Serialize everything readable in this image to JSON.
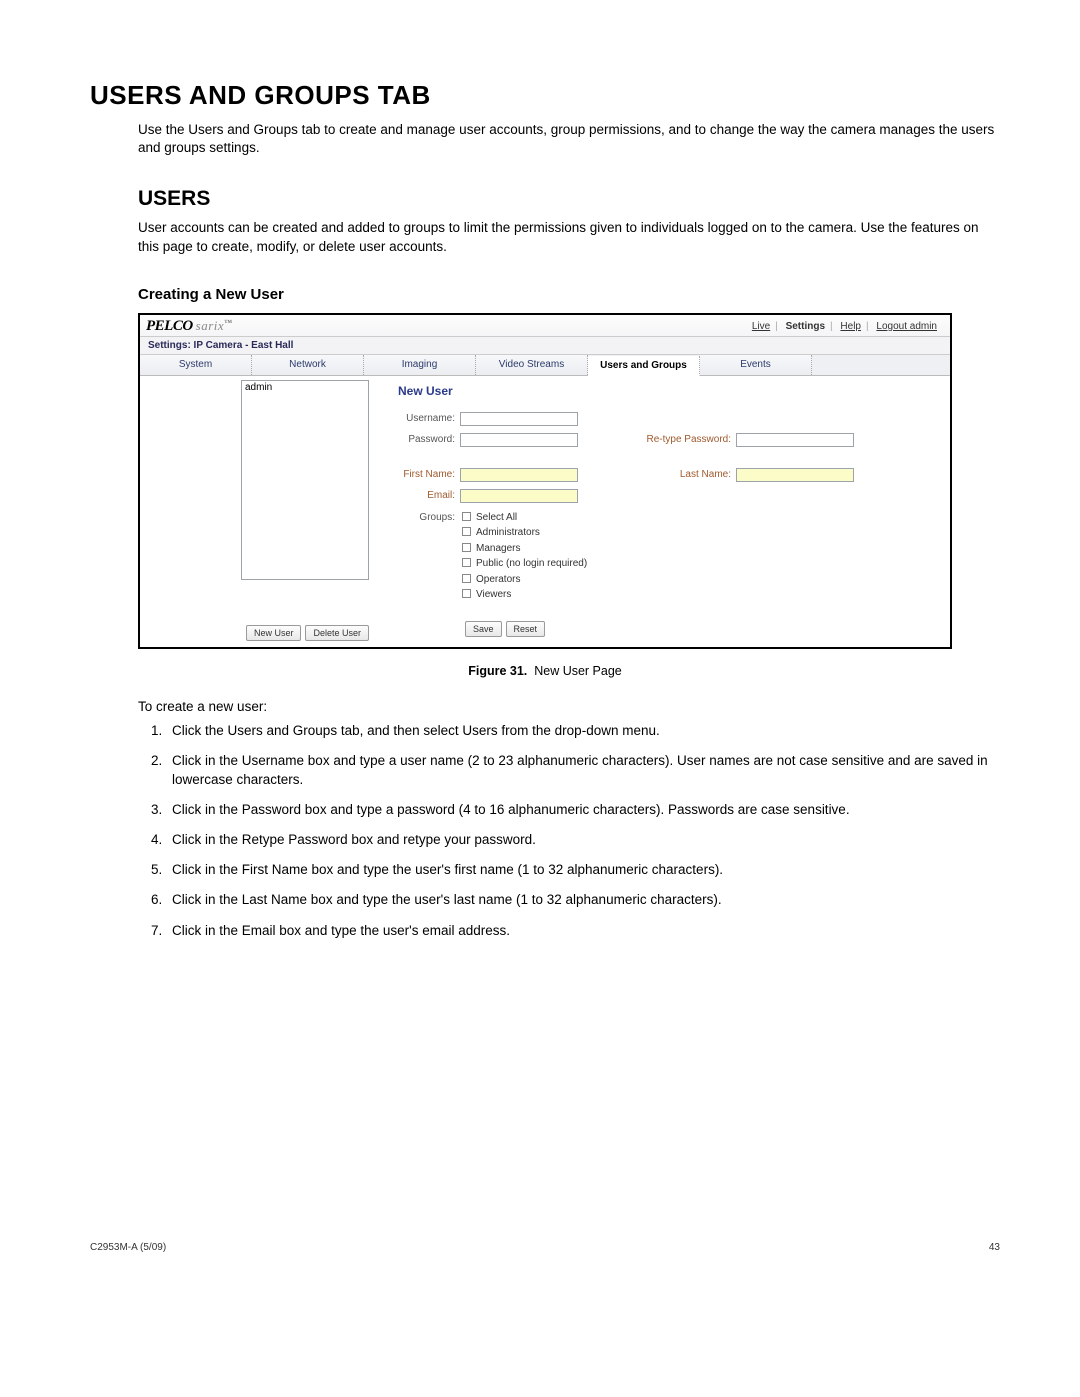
{
  "headings": {
    "main": "USERS AND GROUPS TAB",
    "users": "USERS",
    "creating": "Creating a New User"
  },
  "paragraphs": {
    "intro": "Use the Users and Groups tab to create and manage user accounts, group permissions, and to change the way the camera manages the users and groups settings.",
    "users_intro": "User accounts can be created and added to groups to limit the permissions given to individuals logged on to the camera. Use the features on this page to create, modify, or delete user accounts.",
    "to_create": "To create a new user:"
  },
  "figure": {
    "caption_label": "Figure 31.",
    "caption_text": "New User Page"
  },
  "ui": {
    "logo_brand1": "PELCO",
    "logo_brand2": "sarix",
    "logo_tm": "™",
    "toplinks": {
      "live": "Live",
      "settings": "Settings",
      "help": "Help",
      "logout": "Logout admin"
    },
    "settings_label": "Settings: IP Camera - East Hall",
    "tabs": {
      "system": "System",
      "network": "Network",
      "imaging": "Imaging",
      "video": "Video Streams",
      "users": "Users and Groups",
      "events": "Events"
    },
    "userlist_item": "admin",
    "sidebar_buttons": {
      "new_user": "New User",
      "delete_user": "Delete User"
    },
    "form_title": "New User",
    "labels": {
      "username": "Username:",
      "password": "Password:",
      "retype": "Re-type Password:",
      "firstname": "First Name:",
      "lastname": "Last Name:",
      "email": "Email:",
      "groups": "Groups:"
    },
    "groups": {
      "select_all": "Select All",
      "administrators": "Administrators",
      "managers": "Managers",
      "public": "Public (no login required)",
      "operators": "Operators",
      "viewers": "Viewers"
    },
    "form_buttons": {
      "save": "Save",
      "reset": "Reset"
    }
  },
  "steps": {
    "s1": "Click the Users and Groups tab, and then select Users from the drop-down menu.",
    "s2": "Click in the Username box and type a user name (2 to 23 alphanumeric characters). User names are not case sensitive and are saved in lowercase characters.",
    "s3": "Click in the Password box and type a password (4 to 16 alphanumeric characters). Passwords are case sensitive.",
    "s4": "Click in the Retype Password box and retype your password.",
    "s5": "Click in the First Name box and type the user's first name (1 to 32 alphanumeric characters).",
    "s6": "Click in the Last Name box and type the user's last name (1 to 32 alphanumeric characters).",
    "s7": "Click in the Email box and type the user's email address."
  },
  "footer": {
    "left": "C2953M-A (5/09)",
    "right": "43"
  }
}
